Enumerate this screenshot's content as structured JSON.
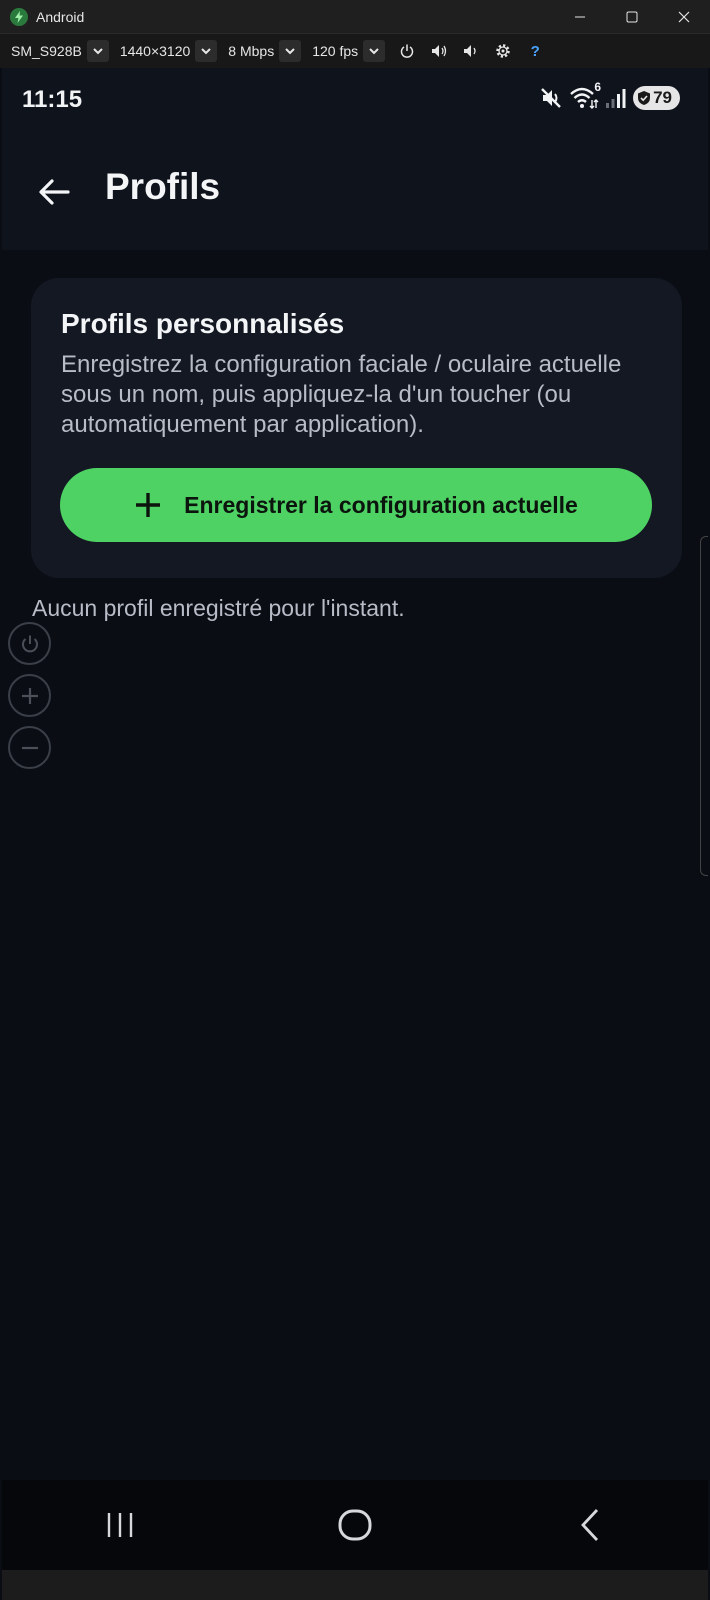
{
  "window": {
    "title": "Android"
  },
  "toolbar": {
    "device": "SM_S928B",
    "resolution": "1440×3120",
    "bitrate": "8 Mbps",
    "fps": "120 fps",
    "help": "?"
  },
  "status_bar": {
    "time": "11:15",
    "wifi_badge": "6",
    "battery": "79"
  },
  "app_bar": {
    "title": "Profils"
  },
  "card": {
    "title": "Profils personnalisés",
    "description": "Enregistrez la configuration faciale / oculaire actuelle sous un nom, puis appliquez-la d'un toucher (ou automatiquement par application).",
    "button_label": "Enregistrer la configuration actuelle"
  },
  "empty_state": {
    "text": "Aucun profil enregistré pour l'instant."
  },
  "colors": {
    "accent": "#4fd264",
    "background": "#0a0d14",
    "card": "#131823"
  }
}
